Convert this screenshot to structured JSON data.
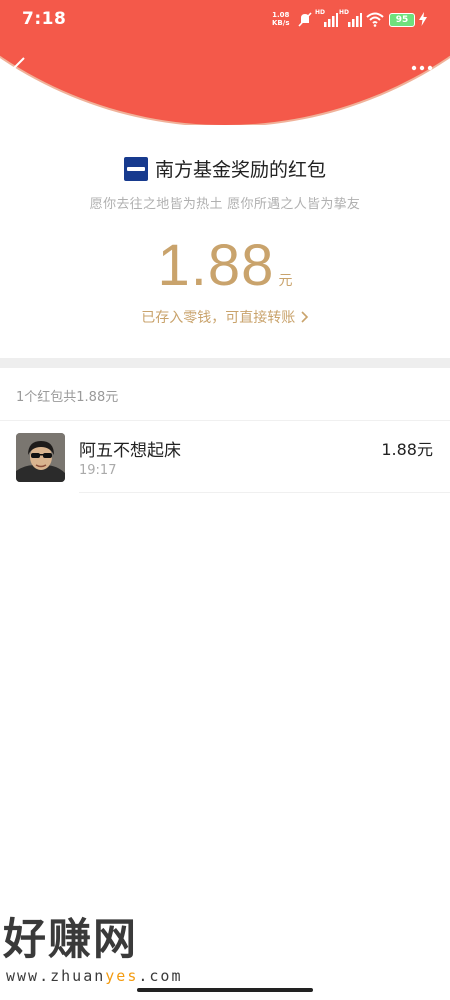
{
  "status_bar": {
    "time": "7:18",
    "net_speed_value": "1.08",
    "net_speed_unit": "KB/s",
    "signal1_label": "HD",
    "signal2_label": "HD",
    "battery": "95"
  },
  "header": {
    "background_color": "#f4594a"
  },
  "sender": {
    "name": "南方基金奖励的红包",
    "blessing": "愿你去往之地皆为热土 愿你所遇之人皆为挚友"
  },
  "amount": {
    "value": "1.88",
    "unit": "元",
    "stored_link": "已存入零钱，可直接转账"
  },
  "summary": {
    "text": "1个红包共1.88元"
  },
  "records": [
    {
      "name": "阿五不想起床",
      "time": "19:17",
      "amount": "1.88元"
    }
  ],
  "watermark": {
    "title": "好赚网",
    "url_part1": "www.zhuan",
    "url_highlight": "yes",
    "url_part3": ".com"
  }
}
